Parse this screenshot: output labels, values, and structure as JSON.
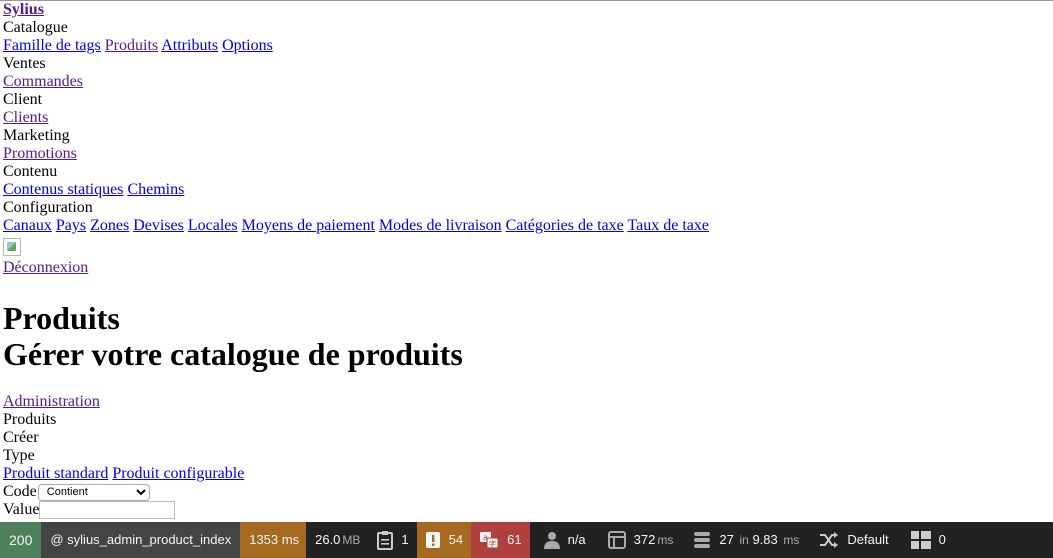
{
  "nav": {
    "brand": "Sylius",
    "sections": [
      {
        "title": "Catalogue",
        "links": [
          "Famille de tags",
          "Produits",
          "Attributs",
          "Options"
        ]
      },
      {
        "title": "Ventes",
        "links": [
          "Commandes"
        ]
      },
      {
        "title": "Client",
        "links": [
          "Clients"
        ]
      },
      {
        "title": "Marketing",
        "links": [
          "Promotions"
        ]
      },
      {
        "title": "Contenu",
        "links": [
          "Contenus statiques",
          "Chemins"
        ]
      },
      {
        "title": "Configuration",
        "links": [
          "Canaux",
          "Pays",
          "Zones",
          "Devises",
          "Locales",
          "Moyens de paiement",
          "Modes de livraison",
          "Catégories de taxe",
          "Taux de taxe"
        ]
      }
    ],
    "logout": "Déconnexion"
  },
  "header": {
    "title": "Produits",
    "subtitle": "Gérer votre catalogue de produits"
  },
  "breadcrumb": {
    "root": "Administration",
    "current": "Produits"
  },
  "actions": {
    "create": "Créer",
    "type_label": "Type",
    "standard": "Produit standard",
    "configurable": "Produit configurable"
  },
  "filters": {
    "code_label": "Code",
    "code_operator": "Contient",
    "value_label": "Value"
  },
  "toolbar": {
    "status": "200",
    "route": "@ sylius_admin_product_index",
    "time": "1353",
    "time_unit": "ms",
    "memory": "26.0",
    "memory_unit": "MB",
    "forms": "1",
    "logs": "54",
    "translations": "61",
    "user": "n/a",
    "twig": "372",
    "twig_unit": "ms",
    "db_queries": "27",
    "db_in": "in",
    "db_time": "9.83",
    "db_unit": "ms",
    "cache": "Default",
    "events": "0"
  }
}
